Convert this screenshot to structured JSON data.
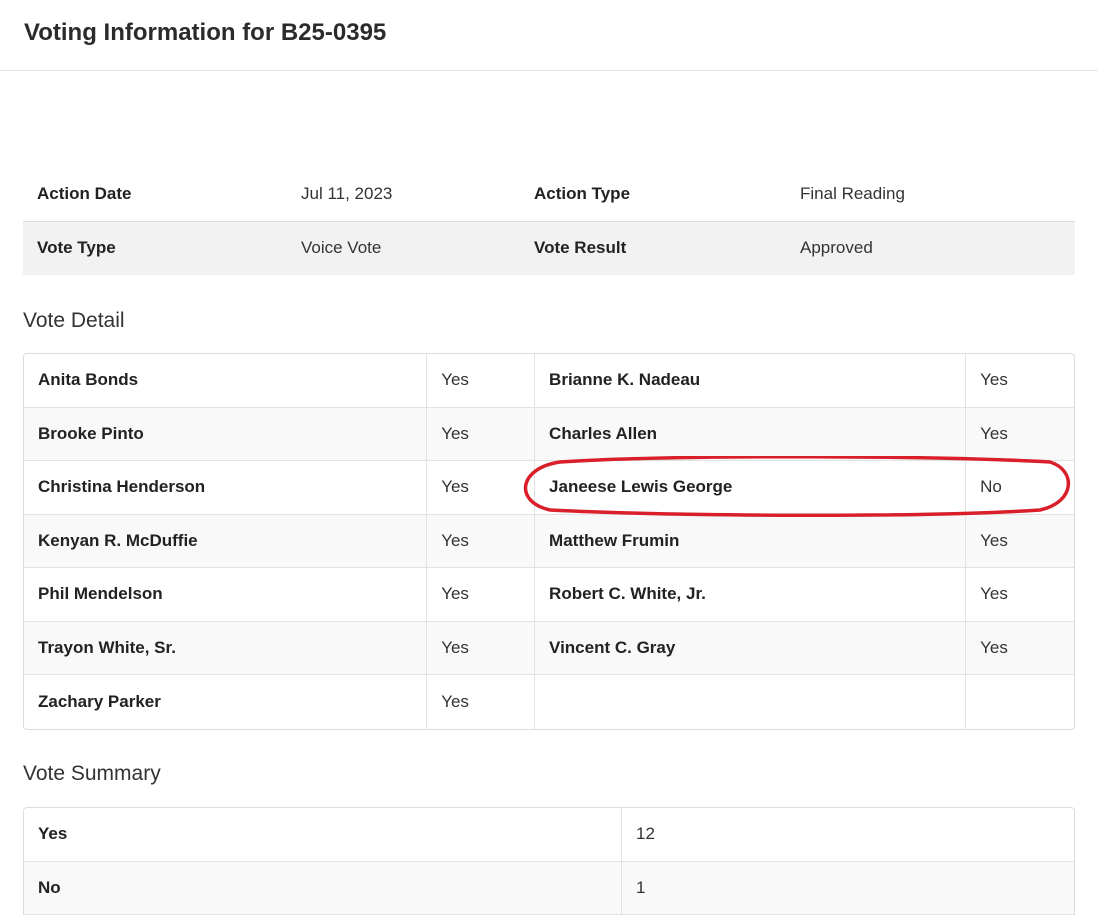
{
  "header": {
    "title": "Voting Information for B25-0395"
  },
  "info": {
    "action_date_label": "Action Date",
    "action_date_value": "Jul 11, 2023",
    "action_type_label": "Action Type",
    "action_type_value": "Final Reading",
    "vote_type_label": "Vote Type",
    "vote_type_value": "Voice Vote",
    "vote_result_label": "Vote Result",
    "vote_result_value": "Approved"
  },
  "vote_detail": {
    "heading": "Vote Detail",
    "rows": [
      {
        "name1": "Anita Bonds",
        "vote1": "Yes",
        "name2": "Brianne K. Nadeau",
        "vote2": "Yes"
      },
      {
        "name1": "Brooke Pinto",
        "vote1": "Yes",
        "name2": "Charles Allen",
        "vote2": "Yes"
      },
      {
        "name1": "Christina Henderson",
        "vote1": "Yes",
        "name2": "Janeese Lewis George",
        "vote2": "No"
      },
      {
        "name1": "Kenyan R. McDuffie",
        "vote1": "Yes",
        "name2": "Matthew Frumin",
        "vote2": "Yes"
      },
      {
        "name1": "Phil Mendelson",
        "vote1": "Yes",
        "name2": "Robert C. White, Jr.",
        "vote2": "Yes"
      },
      {
        "name1": "Trayon White, Sr.",
        "vote1": "Yes",
        "name2": "Vincent C. Gray",
        "vote2": "Yes"
      },
      {
        "name1": "Zachary Parker",
        "vote1": "Yes",
        "name2": "",
        "vote2": ""
      }
    ]
  },
  "vote_summary": {
    "heading": "Vote Summary",
    "rows": [
      {
        "label": "Yes",
        "value": "12"
      },
      {
        "label": "No",
        "value": "1"
      }
    ]
  },
  "colors": {
    "highlight": "#d9202a",
    "row_shade": "#f2f2f2",
    "border": "#dddddd"
  }
}
